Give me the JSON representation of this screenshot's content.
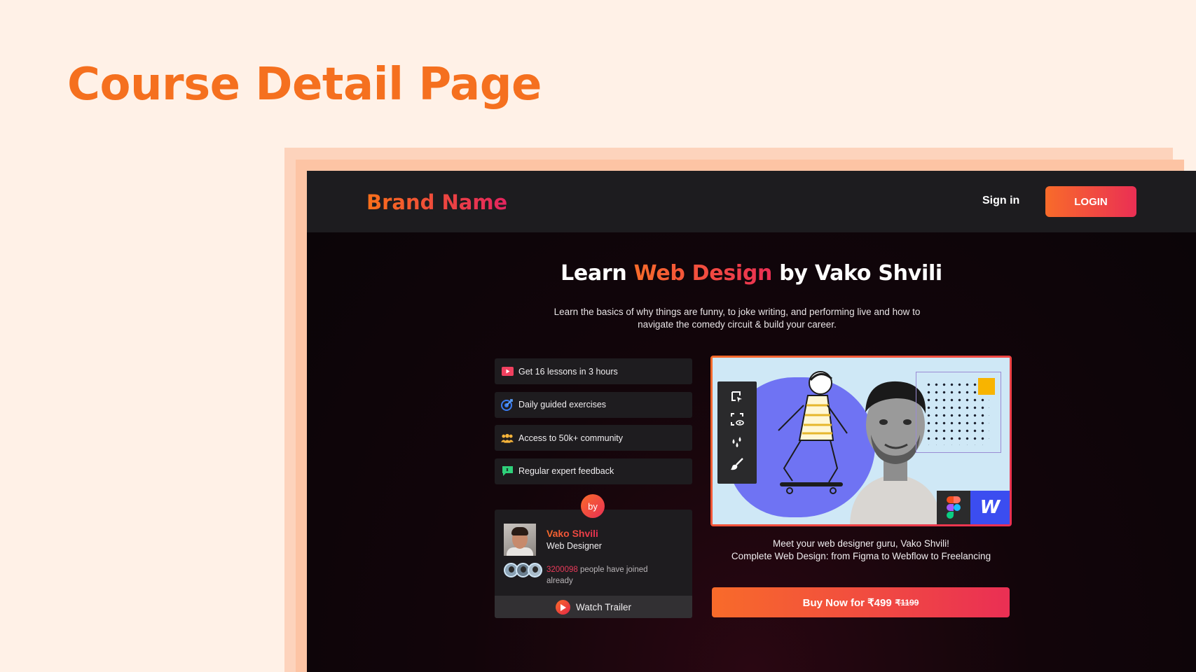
{
  "page": {
    "title": "Course Detail Page"
  },
  "nav": {
    "brand": "Brand Name",
    "signin_label": "Sign in",
    "login_label": "LOGIN"
  },
  "hero": {
    "title_prefix": "Learn ",
    "title_highlight": "Web Design",
    "title_suffix": " by Vako Shvili",
    "subtitle": "Learn the basics of why things are funny, to joke writing, and performing live and how to navigate the comedy circuit & build your career."
  },
  "features": [
    {
      "icon": "play-icon",
      "label": "Get 16 lessons in 3 hours"
    },
    {
      "icon": "target-icon",
      "label": "Daily guided exercises"
    },
    {
      "icon": "community-icon",
      "label": "Access to 50k+ community"
    },
    {
      "icon": "feedback-icon",
      "label": "Regular expert feedback"
    }
  ],
  "instructor": {
    "by_label": "by",
    "name": "Vako Shvili",
    "role": "Web Designer",
    "joined_count": "3200098",
    "joined_text": " people have joined already",
    "trailer_label": "Watch Trailer"
  },
  "media": {
    "caption_line1": "Meet your web designer guru, Vako Shvili!",
    "caption_line2": "Complete Web Design: from Figma to Webflow to Freelancing",
    "webflow_letter": "W"
  },
  "purchase": {
    "buy_label": "Buy Now for ₹499",
    "original_price": "₹1199"
  },
  "colors": {
    "accent_orange": "#f86b2a",
    "accent_pink": "#ea2f54",
    "page_bg": "#fff1e7",
    "title_orange": "#f5701f"
  }
}
